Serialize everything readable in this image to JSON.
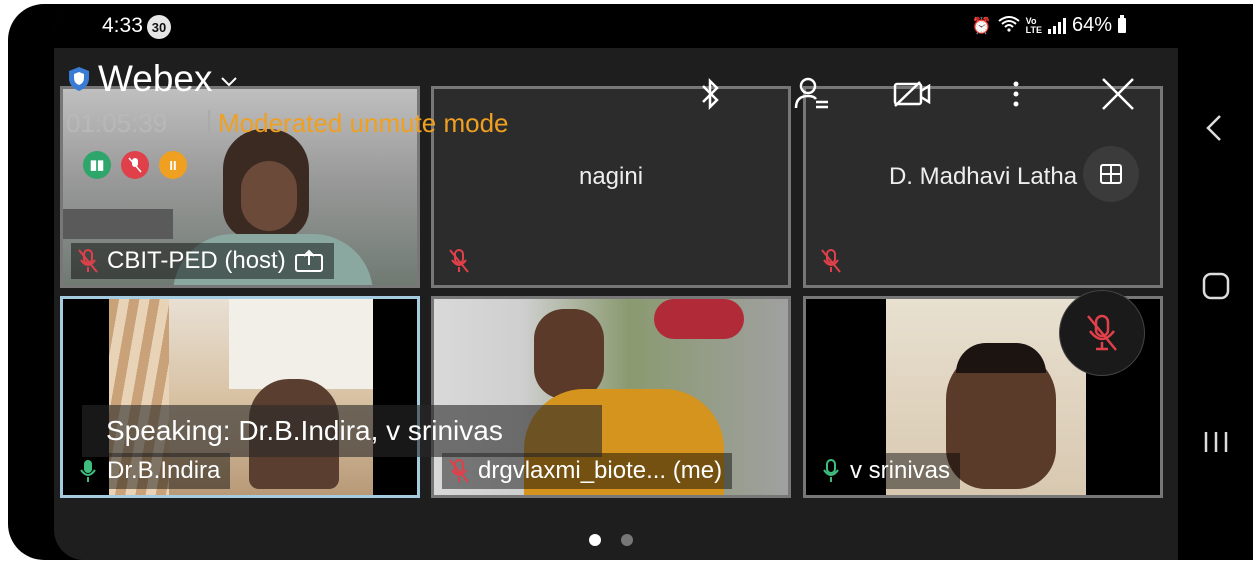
{
  "status_bar": {
    "time": "4:33",
    "notification_badge": "30",
    "battery": "64%"
  },
  "app": {
    "title": "Webex",
    "timer": "01:05:39",
    "mode": "Moderated unmute mode",
    "accent_color": "#f0a020"
  },
  "controls": {
    "icons": [
      "bluetooth-icon",
      "participants-icon",
      "camera-off-icon",
      "more-icon",
      "close-icon"
    ]
  },
  "tiles": [
    {
      "name": "CBIT-PED (host)",
      "mic": "muted",
      "video": true
    },
    {
      "name": "nagini",
      "mic": "muted",
      "video": false
    },
    {
      "name": "D. Madhavi Latha",
      "mic": "muted",
      "video": false
    },
    {
      "name": "Dr.B.Indira",
      "mic": "on",
      "video": true,
      "active": true
    },
    {
      "name": "drgvlaxmi_biote... (me)",
      "mic": "muted",
      "video": true
    },
    {
      "name": "v srinivas",
      "mic": "on",
      "video": true
    }
  ],
  "speaking_banner": "Speaking: Dr.B.Indira, v srinivas",
  "pager": {
    "pages": 2,
    "current": 1
  }
}
